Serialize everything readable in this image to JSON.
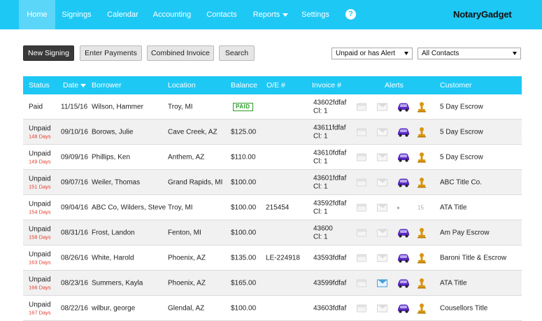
{
  "nav": {
    "items": [
      {
        "label": "Home",
        "active": true
      },
      {
        "label": "Signings"
      },
      {
        "label": "Calendar"
      },
      {
        "label": "Accounting"
      },
      {
        "label": "Contacts"
      },
      {
        "label": "Reports",
        "dropdown": true
      },
      {
        "label": "Settings"
      }
    ],
    "help_label": "?",
    "logo": "NotaryGadget"
  },
  "toolbar": {
    "new_signing": "New Signing",
    "enter_payments": "Enter Payments",
    "combined_invoice": "Combined Invoice",
    "search": "Search",
    "filter_status": "Unpaid or has Alert",
    "filter_contacts": "All Contacts"
  },
  "table": {
    "headers": {
      "status": "Status",
      "date": "Date",
      "borrower": "Borrower",
      "location": "Location",
      "balance": "Balance",
      "oe": "O/E #",
      "invoice": "Invoice #",
      "alerts": "Alerts",
      "customer": "Customer"
    },
    "rows": [
      {
        "status": "Paid",
        "days": "",
        "date": "11/15/16",
        "borrower": "Wilson, Hammer",
        "location": "Troy, MI",
        "balance": "",
        "paid_stamp": "PAID",
        "oe": "",
        "invoice": "43602fdfaf",
        "cl": "Cl: 1",
        "alerts": {
          "mail_active": false,
          "car": true,
          "stamp": true,
          "count": ""
        },
        "customer": "5 Day Escrow"
      },
      {
        "status": "Unpaid",
        "days": "148 Days",
        "date": "09/10/16",
        "borrower": "Borows, Julie",
        "location": "Cave Creek, AZ",
        "balance": "$125.00",
        "paid_stamp": "",
        "oe": "",
        "invoice": "43611fdfaf",
        "cl": "Cl: 1",
        "alerts": {
          "mail_active": false,
          "car": true,
          "stamp": true,
          "count": ""
        },
        "customer": "5 Day Escrow"
      },
      {
        "status": "Unpaid",
        "days": "149 Days",
        "date": "09/09/16",
        "borrower": "Phillips, Ken",
        "location": "Anthem, AZ",
        "balance": "$110.00",
        "paid_stamp": "",
        "oe": "",
        "invoice": "43610fdfaf",
        "cl": "Cl: 1",
        "alerts": {
          "mail_active": false,
          "car": true,
          "stamp": true,
          "count": ""
        },
        "customer": "5 Day Escrow"
      },
      {
        "status": "Unpaid",
        "days": "151 Days",
        "date": "09/07/16",
        "borrower": "Weiler, Thomas",
        "location": "Grand Rapids, MI",
        "balance": "$100.00",
        "paid_stamp": "",
        "oe": "",
        "invoice": "43601fdfaf",
        "cl": "Cl: 1",
        "alerts": {
          "mail_active": false,
          "car": true,
          "stamp": true,
          "count": ""
        },
        "customer": "ABC Title Co."
      },
      {
        "status": "Unpaid",
        "days": "154 Days",
        "date": "09/04/16",
        "borrower": "ABC Co, Wilders, Steve",
        "location": "Troy, MI",
        "balance": "$100.00",
        "paid_stamp": "",
        "oe": "215454",
        "invoice": "43592fdfaf",
        "cl": "Cl: 1",
        "alerts": {
          "mail_active": false,
          "car": false,
          "stamp": false,
          "count": "15"
        },
        "customer": "ATA Title"
      },
      {
        "status": "Unpaid",
        "days": "158 Days",
        "date": "08/31/16",
        "borrower": "Frost, Landon",
        "location": "Fenton, MI",
        "balance": "$100.00",
        "paid_stamp": "",
        "oe": "",
        "invoice": "43600",
        "cl": "Cl: 1",
        "alerts": {
          "mail_active": false,
          "car": true,
          "stamp": true,
          "count": ""
        },
        "customer": "Am Pay Escrow"
      },
      {
        "status": "Unpaid",
        "days": "163 Days",
        "date": "08/26/16",
        "borrower": "White, Harold",
        "location": "Phoenix, AZ",
        "balance": "$135.00",
        "paid_stamp": "",
        "oe": "LE-224918",
        "invoice": "43593fdfaf",
        "cl": "",
        "alerts": {
          "mail_active": false,
          "car": true,
          "stamp": true,
          "count": ""
        },
        "customer": "Baroni Title & Escrow"
      },
      {
        "status": "Unpaid",
        "days": "166 Days",
        "date": "08/23/16",
        "borrower": "Summers, Kayla",
        "location": "Phoenix, AZ",
        "balance": "$165.00",
        "paid_stamp": "",
        "oe": "",
        "invoice": "43599fdfaf",
        "cl": "",
        "alerts": {
          "mail_active": true,
          "car": true,
          "stamp": true,
          "count": ""
        },
        "customer": "ATA Title"
      },
      {
        "status": "Unpaid",
        "days": "167 Days",
        "date": "08/22/16",
        "borrower": "wilbur, george",
        "location": "Glendal, AZ",
        "balance": "$100.00",
        "paid_stamp": "",
        "oe": "",
        "invoice": "43603fdfaf",
        "cl": "",
        "alerts": {
          "mail_active": false,
          "car": true,
          "stamp": true,
          "count": ""
        },
        "customer": "Cousellors Title"
      }
    ]
  },
  "colors": {
    "nav_bg": "#1ec8f5",
    "overdue_text": "#e23a2a",
    "car_icon": "#5a2bc4",
    "stamp_icon": "#d9950f",
    "paid_green": "#2a9a2a"
  }
}
